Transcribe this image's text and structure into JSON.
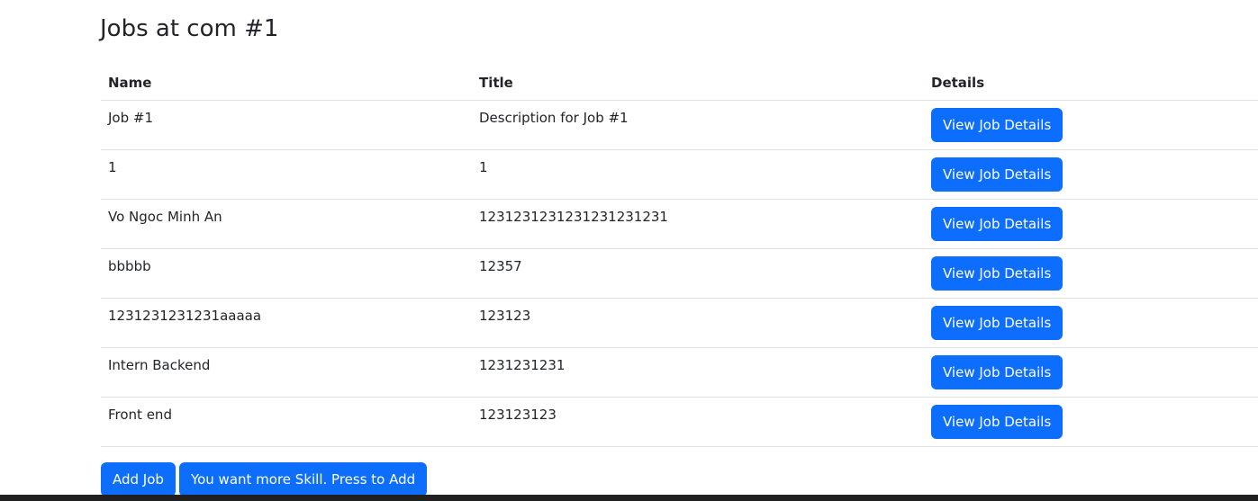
{
  "page": {
    "title": "Jobs at com #1"
  },
  "table": {
    "headers": {
      "name": "Name",
      "title": "Title",
      "details": "Details"
    },
    "rows": [
      {
        "name": "Job #1",
        "title": "Description for Job #1",
        "action": "View Job Details"
      },
      {
        "name": "1",
        "title": "1",
        "action": "View Job Details"
      },
      {
        "name": "Vo Ngoc Minh An",
        "title": "1231231231231231231231",
        "action": "View Job Details"
      },
      {
        "name": "bbbbb",
        "title": "12357",
        "action": "View Job Details"
      },
      {
        "name": "1231231231231aaaaa",
        "title": "123123",
        "action": "View Job Details"
      },
      {
        "name": "Intern Backend",
        "title": "1231231231",
        "action": "View Job Details"
      },
      {
        "name": "Front end",
        "title": "123123123",
        "action": "View Job Details"
      }
    ]
  },
  "footer": {
    "add_job_label": "Add Job",
    "add_skill_label": "You want more Skill. Press to Add"
  },
  "colors": {
    "primary": "#0d6efd",
    "text": "#212529",
    "border": "#dee2e6"
  }
}
